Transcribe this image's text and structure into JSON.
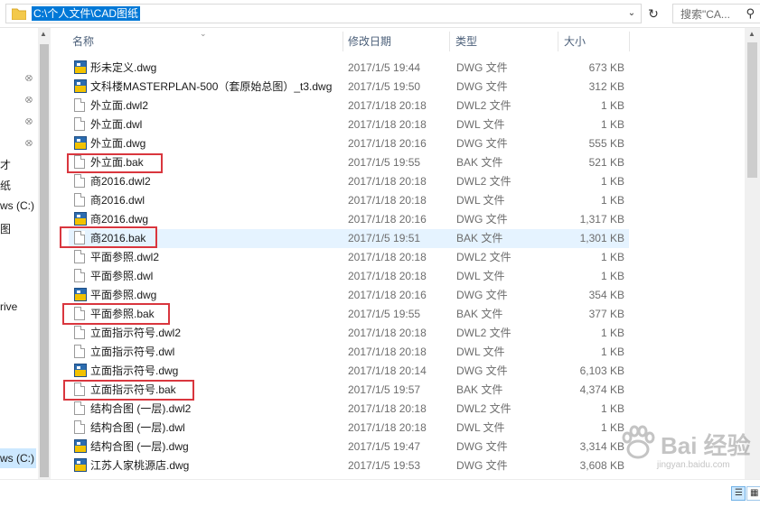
{
  "address": {
    "path": "C:\\个人文件\\CAD图纸",
    "search_placeholder": "搜索\"CA...",
    "refresh_icon": "refresh-icon",
    "search_icon": "search-icon"
  },
  "nav": {
    "labels": [
      "才",
      "纸",
      "ws (C:)",
      "图",
      "rive",
      "ws (C:)"
    ]
  },
  "columns": {
    "name": "名称",
    "date": "修改日期",
    "type": "类型",
    "size": "大小"
  },
  "files": [
    {
      "name": "形未定义.dwg",
      "date": "2017/1/5 19:44",
      "type": "DWG 文件",
      "size": "673 KB",
      "icon": "dwg-file-icon"
    },
    {
      "name": "文科楼MASTERPLAN-500（套原始总图）_t3.dwg",
      "date": "2017/1/5 19:50",
      "type": "DWG 文件",
      "size": "312 KB",
      "icon": "dwg-file-icon"
    },
    {
      "name": "外立面.dwl2",
      "date": "2017/1/18 20:18",
      "type": "DWL2 文件",
      "size": "1 KB",
      "icon": "blank-file-icon"
    },
    {
      "name": "外立面.dwl",
      "date": "2017/1/18 20:18",
      "type": "DWL 文件",
      "size": "1 KB",
      "icon": "blank-file-icon"
    },
    {
      "name": "外立面.dwg",
      "date": "2017/1/18 20:16",
      "type": "DWG 文件",
      "size": "555 KB",
      "icon": "dwg-file-icon"
    },
    {
      "name": "外立面.bak",
      "date": "2017/1/5 19:55",
      "type": "BAK 文件",
      "size": "521 KB",
      "icon": "blank-file-icon"
    },
    {
      "name": "商2016.dwl2",
      "date": "2017/1/18 20:18",
      "type": "DWL2 文件",
      "size": "1 KB",
      "icon": "blank-file-icon"
    },
    {
      "name": "商2016.dwl",
      "date": "2017/1/18 20:18",
      "type": "DWL 文件",
      "size": "1 KB",
      "icon": "blank-file-icon"
    },
    {
      "name": "商2016.dwg",
      "date": "2017/1/18 20:16",
      "type": "DWG 文件",
      "size": "1,317 KB",
      "icon": "dwg-file-icon"
    },
    {
      "name": "商2016.bak",
      "date": "2017/1/5 19:51",
      "type": "BAK 文件",
      "size": "1,301 KB",
      "icon": "blank-file-icon"
    },
    {
      "name": "平面参照.dwl2",
      "date": "2017/1/18 20:18",
      "type": "DWL2 文件",
      "size": "1 KB",
      "icon": "blank-file-icon"
    },
    {
      "name": "平面参照.dwl",
      "date": "2017/1/18 20:18",
      "type": "DWL 文件",
      "size": "1 KB",
      "icon": "blank-file-icon"
    },
    {
      "name": "平面参照.dwg",
      "date": "2017/1/18 20:16",
      "type": "DWG 文件",
      "size": "354 KB",
      "icon": "dwg-file-icon"
    },
    {
      "name": "平面参照.bak",
      "date": "2017/1/5 19:55",
      "type": "BAK 文件",
      "size": "377 KB",
      "icon": "blank-file-icon"
    },
    {
      "name": "立面指示符号.dwl2",
      "date": "2017/1/18 20:18",
      "type": "DWL2 文件",
      "size": "1 KB",
      "icon": "blank-file-icon"
    },
    {
      "name": "立面指示符号.dwl",
      "date": "2017/1/18 20:18",
      "type": "DWL 文件",
      "size": "1 KB",
      "icon": "blank-file-icon"
    },
    {
      "name": "立面指示符号.dwg",
      "date": "2017/1/18 20:14",
      "type": "DWG 文件",
      "size": "6,103 KB",
      "icon": "dwg-file-icon"
    },
    {
      "name": "立面指示符号.bak",
      "date": "2017/1/5 19:57",
      "type": "BAK 文件",
      "size": "4,374 KB",
      "icon": "blank-file-icon"
    },
    {
      "name": "结构合图 (一层).dwl2",
      "date": "2017/1/18 20:18",
      "type": "DWL2 文件",
      "size": "1 KB",
      "icon": "blank-file-icon"
    },
    {
      "name": "结构合图 (一层).dwl",
      "date": "2017/1/18 20:18",
      "type": "DWL 文件",
      "size": "1 KB",
      "icon": "blank-file-icon"
    },
    {
      "name": "结构合图 (一层).dwg",
      "date": "2017/1/5 19:47",
      "type": "DWG 文件",
      "size": "3,314 KB",
      "icon": "dwg-file-icon"
    },
    {
      "name": "江苏人家桃源店.dwg",
      "date": "2017/1/5 19:53",
      "type": "DWG 文件",
      "size": "3,608 KB",
      "icon": "dwg-file-icon"
    }
  ],
  "watermark": {
    "brand": "Bai 经验",
    "url": "jingyan.baidu.com"
  },
  "colors": {
    "selection": "#0078d7",
    "highlight_box": "#d9363e",
    "hover_row": "#e5f3ff"
  }
}
